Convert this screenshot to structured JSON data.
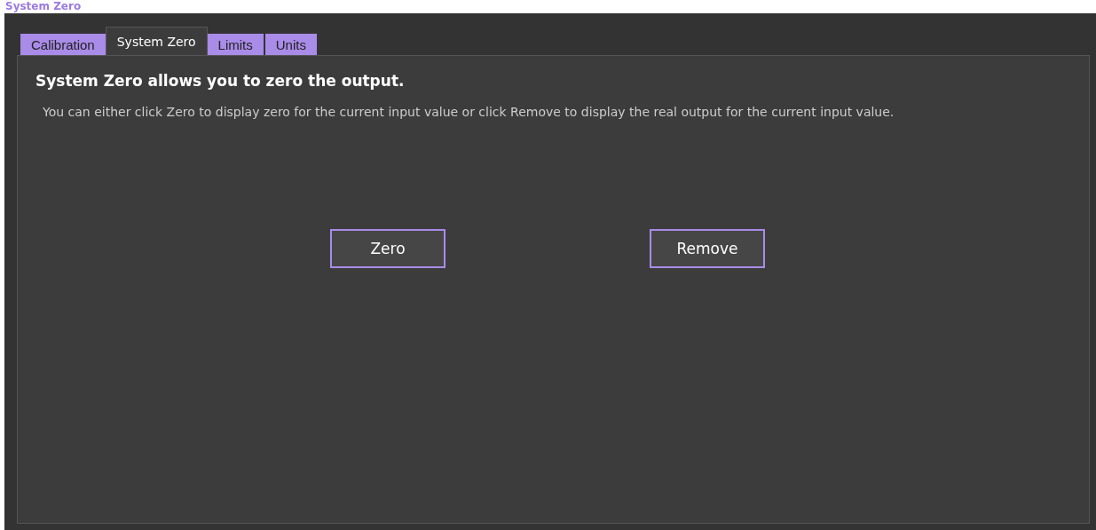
{
  "page_title": "System Zero",
  "tabs": [
    {
      "label": "Calibration",
      "selected": false
    },
    {
      "label": "System Zero",
      "selected": true
    },
    {
      "label": "Limits",
      "selected": false
    },
    {
      "label": "Units",
      "selected": false
    }
  ],
  "panel": {
    "heading": "System Zero allows you to zero the output.",
    "description": "You can either click Zero to display zero for the current input value or click Remove to display the real output for the current input value."
  },
  "buttons": [
    "Zero",
    "Remove"
  ]
}
